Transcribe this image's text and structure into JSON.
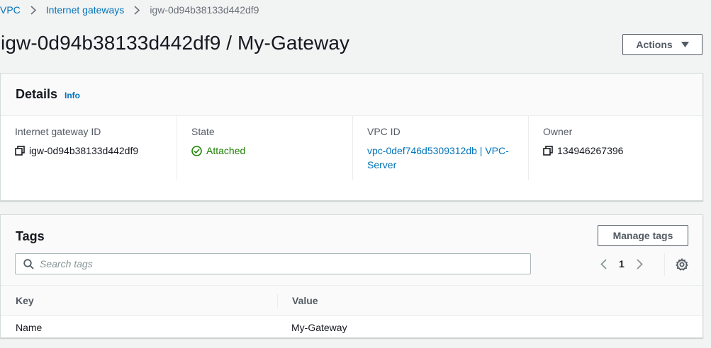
{
  "breadcrumb": {
    "items": [
      "VPC",
      "Internet gateways"
    ],
    "current": "igw-0d94b38133d442df9"
  },
  "page_title": "igw-0d94b38133d442df9 / My-Gateway",
  "actions_label": "Actions",
  "details": {
    "title": "Details",
    "info": "Info",
    "fields": [
      {
        "label": "Internet gateway ID",
        "value": "igw-0d94b38133d442df9"
      },
      {
        "label": "State",
        "value": "Attached"
      },
      {
        "label": "VPC ID",
        "value_line1": "vpc-0def746d5309312db | VPC-",
        "value_line2": "Server"
      },
      {
        "label": "Owner",
        "value": "134946267396"
      }
    ]
  },
  "tags": {
    "title": "Tags",
    "manage_label": "Manage tags",
    "search_placeholder": "Search tags",
    "page": "1",
    "columns": [
      "Key",
      "Value"
    ],
    "rows": [
      {
        "key": "Name",
        "value": "My-Gateway"
      }
    ]
  },
  "colors": {
    "link": "#0073bb",
    "success": "#1d8102",
    "background": "#f2f3f3"
  },
  "icons": [
    "chevron-right-icon",
    "caret-down-icon",
    "copy-icon",
    "success-check-icon",
    "search-icon",
    "chevron-left-icon",
    "gear-icon"
  ]
}
